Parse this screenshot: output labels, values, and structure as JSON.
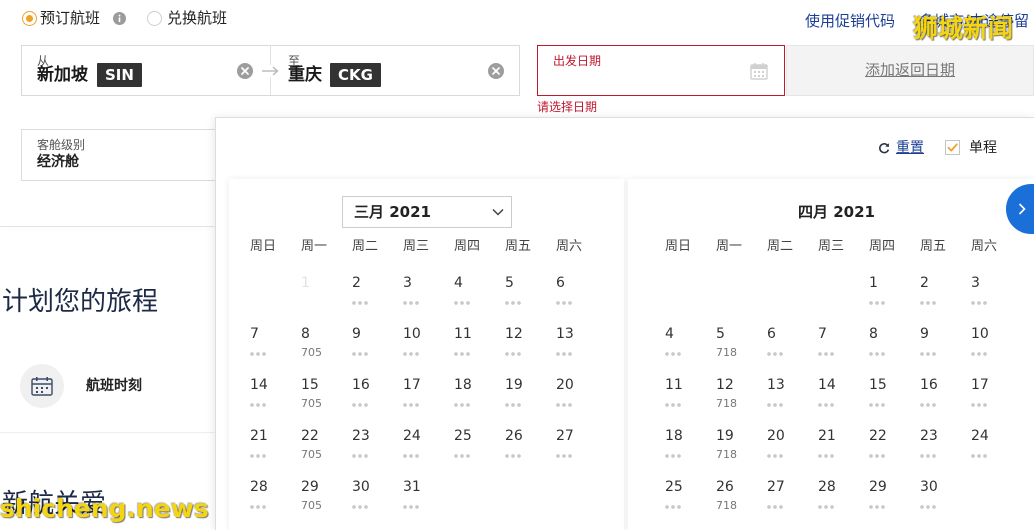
{
  "trip_type": {
    "options": [
      {
        "label": "预订航班",
        "selected": true
      },
      {
        "label": "兑换航班",
        "selected": false
      }
    ]
  },
  "header_links": {
    "promo_code": "使用促销代码",
    "multi_city": "多城市/中途停留"
  },
  "search": {
    "origin": {
      "label": "从",
      "city": "新加坡",
      "code": "SIN"
    },
    "destination": {
      "label": "至",
      "city": "重庆",
      "code": "CKG"
    },
    "departure": {
      "label": "出发日期",
      "error": "请选择日期"
    },
    "add_return_label": "添加返回日期",
    "cabin": {
      "label": "客舱级别",
      "value": "经济舱"
    }
  },
  "sidebar": {
    "heading": "计划您的旅程",
    "schedule_label": "航班时刻",
    "kris_care_heading": "新航关爱"
  },
  "calendar": {
    "reset_label": "重置",
    "one_way": {
      "label": "单程",
      "checked": true
    },
    "weekdays": [
      "周日",
      "周一",
      "周二",
      "周三",
      "周四",
      "周五",
      "周六"
    ],
    "months": [
      {
        "title": "三月 2021",
        "weeks": [
          [
            null,
            {
              "day": "1",
              "disabled": true
            },
            {
              "day": "2"
            },
            {
              "day": "3"
            },
            {
              "day": "4"
            },
            {
              "day": "5"
            },
            {
              "day": "6"
            }
          ],
          [
            {
              "day": "7"
            },
            {
              "day": "8",
              "fare": "705"
            },
            {
              "day": "9"
            },
            {
              "day": "10"
            },
            {
              "day": "11"
            },
            {
              "day": "12"
            },
            {
              "day": "13"
            }
          ],
          [
            {
              "day": "14"
            },
            {
              "day": "15",
              "fare": "705"
            },
            {
              "day": "16"
            },
            {
              "day": "17"
            },
            {
              "day": "18"
            },
            {
              "day": "19"
            },
            {
              "day": "20"
            }
          ],
          [
            {
              "day": "21"
            },
            {
              "day": "22",
              "fare": "705"
            },
            {
              "day": "23"
            },
            {
              "day": "24"
            },
            {
              "day": "25"
            },
            {
              "day": "26"
            },
            {
              "day": "27"
            }
          ],
          [
            {
              "day": "28"
            },
            {
              "day": "29",
              "fare": "705"
            },
            {
              "day": "30"
            },
            {
              "day": "31"
            }
          ]
        ]
      },
      {
        "title": "四月 2021",
        "weeks": [
          [
            null,
            null,
            null,
            null,
            {
              "day": "1"
            },
            {
              "day": "2"
            },
            {
              "day": "3"
            }
          ],
          [
            {
              "day": "4"
            },
            {
              "day": "5",
              "fare": "718"
            },
            {
              "day": "6"
            },
            {
              "day": "7"
            },
            {
              "day": "8"
            },
            {
              "day": "9"
            },
            {
              "day": "10"
            }
          ],
          [
            {
              "day": "11"
            },
            {
              "day": "12",
              "fare": "718"
            },
            {
              "day": "13"
            },
            {
              "day": "14"
            },
            {
              "day": "15"
            },
            {
              "day": "16"
            },
            {
              "day": "17"
            }
          ],
          [
            {
              "day": "18"
            },
            {
              "day": "19",
              "fare": "718"
            },
            {
              "day": "20"
            },
            {
              "day": "21"
            },
            {
              "day": "22"
            },
            {
              "day": "23"
            },
            {
              "day": "24"
            }
          ],
          [
            {
              "day": "25"
            },
            {
              "day": "26",
              "fare": "718"
            },
            {
              "day": "27"
            },
            {
              "day": "28"
            },
            {
              "day": "29"
            },
            {
              "day": "30"
            }
          ]
        ]
      }
    ]
  },
  "watermarks": {
    "top_right": "狮城新闻",
    "bottom_left": "shicheng.news"
  },
  "colors": {
    "accent_orange": "#efa12a",
    "link_navy": "#1c3f94",
    "error_red": "#c0182d",
    "badge_bg": "#333333",
    "next_button_blue": "#1b6fd8",
    "watermark_yellow": "#f4d50f"
  }
}
